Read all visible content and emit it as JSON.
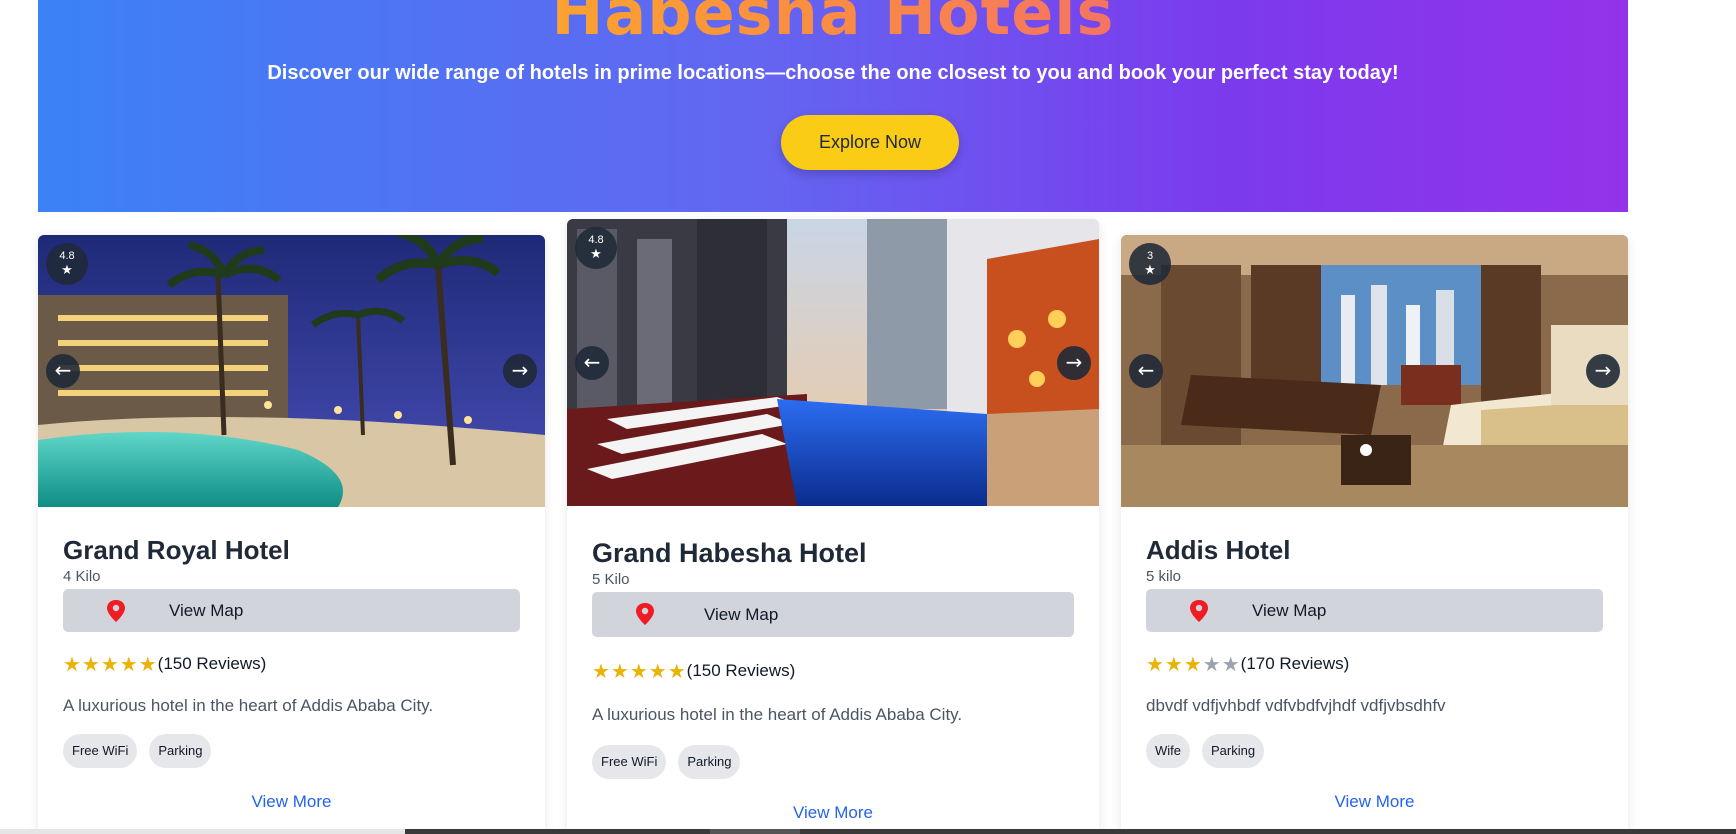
{
  "hero": {
    "title": "Habesha Hotels",
    "subtitle": "Discover our wide range of hotels in prime locations—choose the one closest to you and book your perfect stay today!",
    "cta_label": "Explore Now"
  },
  "icons": {
    "prev": "←",
    "next": "→",
    "star": "★",
    "pin": "map-pin-icon"
  },
  "hotels": [
    {
      "rating": "4.8",
      "name": "Grand Royal Hotel",
      "distance": "4 Kilo",
      "map_label": "View Map",
      "stars_filled": 5,
      "reviews": "(150 Reviews)",
      "description": "A luxurious hotel in the heart of Addis Ababa City.",
      "tags": [
        "Free WiFi",
        "Parking"
      ],
      "more_label": "View More"
    },
    {
      "rating": "4.8",
      "name": "Grand Habesha Hotel",
      "distance": "5 Kilo",
      "map_label": "View Map",
      "stars_filled": 5,
      "reviews": "(150 Reviews)",
      "description": "A luxurious hotel in the heart of Addis Ababa City.",
      "tags": [
        "Free WiFi",
        "Parking"
      ],
      "more_label": "View More"
    },
    {
      "rating": "3",
      "name": "Addis Hotel",
      "distance": "5 kilo",
      "map_label": "View Map",
      "stars_filled": 3,
      "reviews": "(170 Reviews)",
      "description": "dbvdf vdfjvhbdf vdfvbdfvjhdf vdfjvbsdhfv",
      "tags": [
        "Wife",
        "Parking"
      ],
      "more_label": "View More"
    }
  ],
  "colors": {
    "hero_gradient_start": "#3b82f6",
    "hero_gradient_end": "#9333ea",
    "cta": "#facc15",
    "star_on": "#eab308",
    "star_off": "#9ca3af",
    "link": "#2563eb",
    "pin": "#ef1c24"
  }
}
